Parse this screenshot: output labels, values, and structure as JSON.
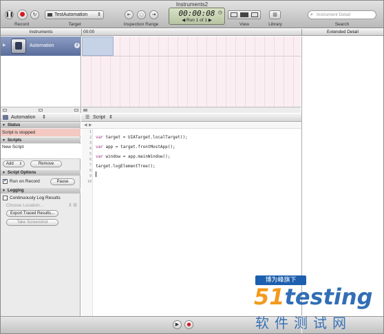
{
  "window": {
    "title": "Instruments2"
  },
  "toolbar": {
    "record_label": "Record",
    "target_label": "Target",
    "target_value": "TestAutomation",
    "inspection_label": "Inspection Range",
    "timer": "00:00:08",
    "run_text": "Run 1 of 1",
    "view_label": "View",
    "library_label": "Library",
    "search_placeholder": "Instrument Detail",
    "search_label": "Search"
  },
  "headers": {
    "instruments": "Instruments",
    "timeline_time": "00:00",
    "extended_detail": "Extended Detail"
  },
  "instrument": {
    "name": "Automation"
  },
  "left_panel": {
    "selector_value": "Automation",
    "status_header": "Status",
    "status_text": "Script is stopped",
    "scripts_header": "Scripts",
    "script_name": "New Script",
    "add_label": "Add",
    "remove_label": "Remove",
    "options_header": "Script Options",
    "run_on_record_label": "Run on Record",
    "pause_label": "Pause",
    "logging_header": "Logging",
    "continuous_log_label": "Continuously Log Results",
    "choose_location_label": "Choose Location...",
    "export_label": "Export Traced Results...",
    "screenshot_label": "Take Screenshot"
  },
  "editor": {
    "jump_label": "Script",
    "line_numbers": [
      "1",
      "2",
      "3",
      "4",
      "5",
      "6",
      "7",
      "8",
      "9",
      "10"
    ],
    "code": [
      {
        "kw": "var",
        "rest": " target = UIATarget.localTarget();"
      },
      {
        "kw": "var",
        "rest": " app = target.frontMostApp();"
      },
      {
        "kw": "var",
        "rest": " window = app.mainWindow();"
      },
      {
        "kw": "",
        "rest": "target.logElementTree();"
      }
    ]
  },
  "watermark": {
    "banner": "博为峰旗下",
    "logo_number": "51",
    "logo_word": "testing",
    "subtitle": "软件测试网"
  },
  "colors": {
    "accent_blue": "#5a6d9c",
    "status_pink": "#f3c9c2",
    "watermark_blue": "#1c5fae",
    "record_red": "#d9191c"
  }
}
